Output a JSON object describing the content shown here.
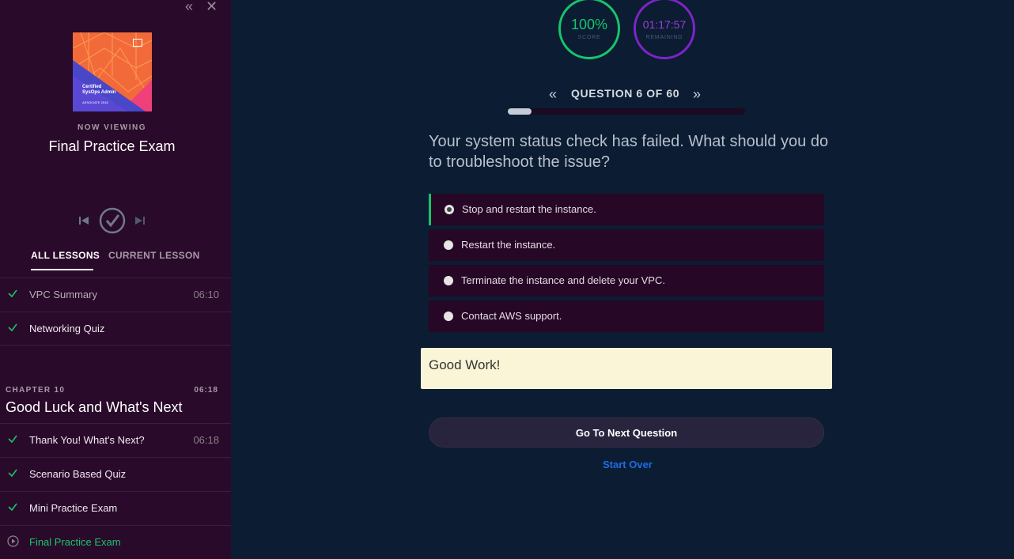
{
  "sidebar": {
    "now_viewing_label": "NOW VIEWING",
    "now_viewing_title": "Final Practice Exam",
    "course_thumb": {
      "title_line1": "Certified",
      "title_line2": "SysOps Admin",
      "subtitle": "ASSOCIATE 2018"
    },
    "tabs": {
      "all": "ALL LESSONS",
      "current": "CURRENT LESSON"
    },
    "lessons_before": [
      {
        "label": "VPC Summary",
        "duration": "06:10"
      },
      {
        "label": "Networking Quiz",
        "duration": ""
      }
    ],
    "chapter": {
      "label": "CHAPTER 10",
      "duration": "06:18",
      "title": "Good Luck and What's Next"
    },
    "chapter_lessons": [
      {
        "label": "Thank You! What's Next?",
        "duration": "06:18"
      },
      {
        "label": "Scenario Based Quiz",
        "duration": ""
      },
      {
        "label": "Mini Practice Exam",
        "duration": ""
      },
      {
        "label": "Final Practice Exam",
        "duration": ""
      }
    ]
  },
  "stats": {
    "score_value": "100%",
    "score_label": "SCORE",
    "time_value": "01:17:57",
    "time_label": "REMAINING"
  },
  "question": {
    "counter": "QUESTION 6 OF 60",
    "progress": 0.1,
    "text": "Your system status check has failed. What should you do to troubleshoot the issue?",
    "options": [
      "Stop and restart the instance.",
      "Restart the instance.",
      "Terminate the instance and delete your VPC.",
      "Contact AWS support."
    ],
    "selected_index": 0
  },
  "feedback": "Good Work!",
  "actions": {
    "next": "Go To Next Question",
    "start_over": "Start Over"
  },
  "colors": {
    "accent_green": "#16c56b",
    "accent_purple": "#7f24c9",
    "link_blue": "#1f6ce6",
    "sidebar_bg": "#2a0a2a",
    "main_bg": "#0b1c33"
  },
  "icons": [
    "collapse-icon",
    "close-icon",
    "skip-previous-icon",
    "check-circle-icon",
    "skip-next-icon",
    "check-icon",
    "play-circle-icon",
    "chevron-double-left-icon",
    "chevron-double-right-icon",
    "radio-icon"
  ]
}
